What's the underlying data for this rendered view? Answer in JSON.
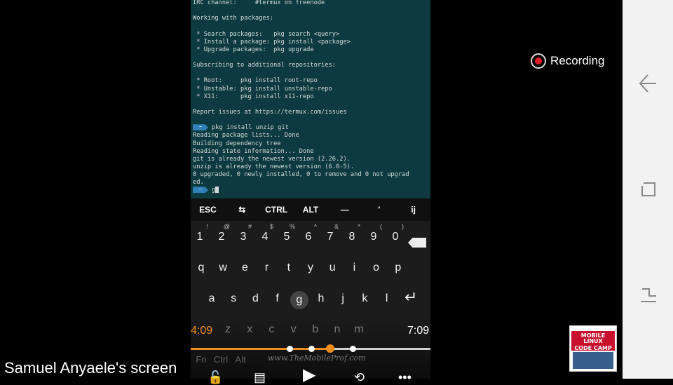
{
  "terminal": {
    "lines": [
      {
        "text": "IRC channel:     #termux on freenode"
      },
      {
        "text": ""
      },
      {
        "text": "Working with packages:"
      },
      {
        "text": ""
      },
      {
        "text": " * Search packages:   pkg search <query>"
      },
      {
        "text": " * Install a package: pkg install <package>"
      },
      {
        "text": " * Upgrade packages:  pkg upgrade"
      },
      {
        "text": ""
      },
      {
        "text": "Subscribing to additional repositories:"
      },
      {
        "text": ""
      },
      {
        "text": " * Root:     pkg install root-repo"
      },
      {
        "text": " * Unstable: pkg install unstable-repo"
      },
      {
        "text": " * X11:      pkg install x11-repo"
      },
      {
        "text": ""
      },
      {
        "text": "Report issues at https://termux.com/issues"
      },
      {
        "text": ""
      },
      {
        "text": "pkg install unzip git",
        "prompt": true
      },
      {
        "text": "Reading package lists... Done"
      },
      {
        "text": "Building dependency tree"
      },
      {
        "text": "Reading state information... Done"
      },
      {
        "text": "git is already the newest version (2.26.2)."
      },
      {
        "text": "unzip is already the newest version (6.0-5)."
      },
      {
        "text": "0 upgraded, 0 newly installed, 0 to remove and 0 not upgrad"
      },
      {
        "text": "ed."
      },
      {
        "text": "g",
        "prompt": true,
        "cursor": true
      }
    ],
    "prompt_glyph": "~"
  },
  "extra_keys": [
    "ESC",
    "⇆",
    "CTRL",
    "ALT",
    "—",
    "′",
    "ij"
  ],
  "keyboard": {
    "row1": [
      {
        "k": "1",
        "s": "!"
      },
      {
        "k": "2",
        "s": "@"
      },
      {
        "k": "3",
        "s": "#"
      },
      {
        "k": "4",
        "s": "$"
      },
      {
        "k": "5",
        "s": "%"
      },
      {
        "k": "6",
        "s": "^"
      },
      {
        "k": "7",
        "s": "&"
      },
      {
        "k": "8",
        "s": "*"
      },
      {
        "k": "9",
        "s": "("
      },
      {
        "k": "0",
        "s": ")"
      }
    ],
    "row2": [
      "q",
      "w",
      "e",
      "r",
      "t",
      "y",
      "u",
      "i",
      "o",
      "p"
    ],
    "row3": [
      "a",
      "s",
      "d",
      "f",
      "g",
      "h",
      "j",
      "k",
      "l"
    ],
    "row4": [
      "z",
      "x",
      "c",
      "v",
      "b",
      "n",
      "m"
    ],
    "row5": [
      "Fn",
      "Ctrl",
      "Alt"
    ]
  },
  "player": {
    "current_time": "4:09",
    "total_time": "7:09",
    "progress_fraction": 0.58,
    "watermark": "www.TheMobileProf.com"
  },
  "caption": "Samuel Anyaele's screen",
  "recording": {
    "label": "Recording"
  },
  "thumbnail": {
    "title_line1": "MOBILE LINUX",
    "title_line2": "CODE CAMP"
  },
  "colors": {
    "accent_orange": "#f08c1c",
    "record_red": "#e01e26",
    "terminal_bg": "#0d3a40",
    "prompt_blue": "#2f7fb8"
  }
}
